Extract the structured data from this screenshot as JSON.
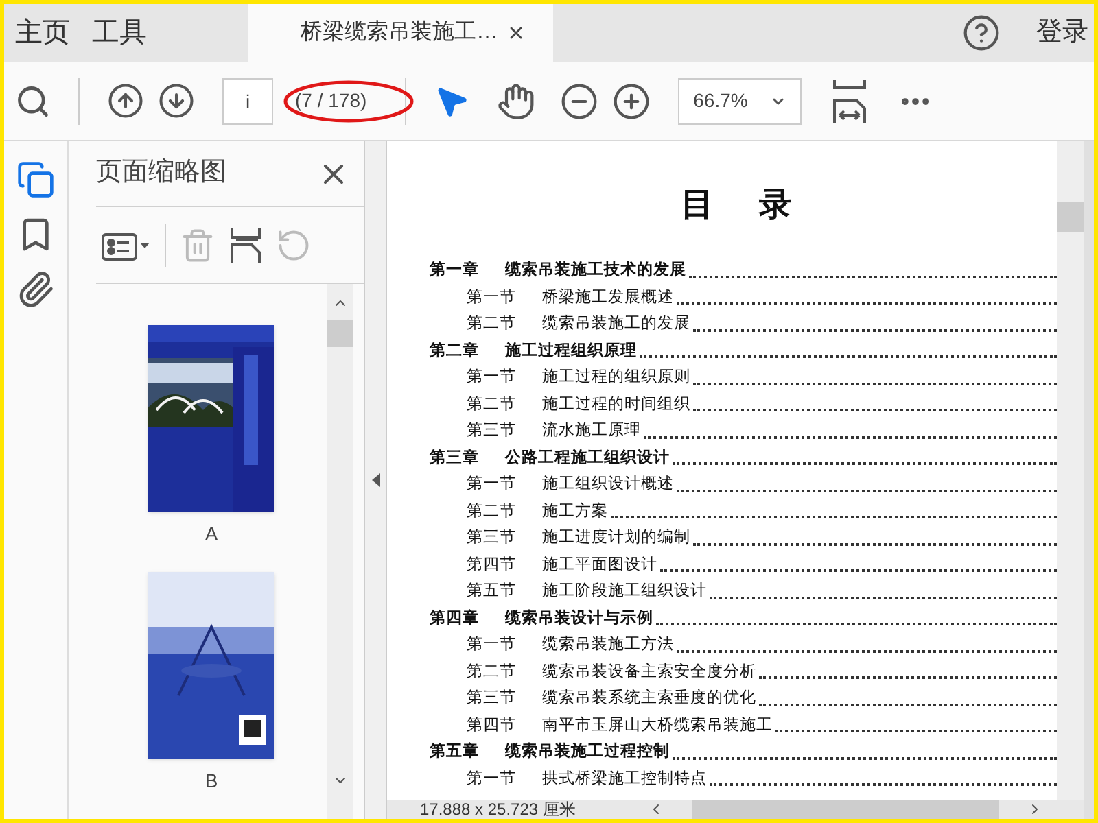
{
  "tabs": [
    {
      "label": "主页",
      "selected": false
    },
    {
      "label": "工具",
      "selected": false
    },
    {
      "label": "桥梁缆索吊装施工…",
      "selected": true
    }
  ],
  "login": "登录",
  "toolbar": {
    "page_field": {
      "value": "i"
    },
    "page_count": "(7 / 178)",
    "zoom": "66.7%"
  },
  "side_nav": [
    {
      "kind": "pages",
      "selected": true
    },
    {
      "kind": "bookmarks",
      "selected": false
    },
    {
      "kind": "attachments",
      "selected": false
    }
  ],
  "thumbnail_panel": {
    "title": "页面缩略图",
    "thumbnails": [
      {
        "label": "A"
      },
      {
        "label": "B"
      }
    ]
  },
  "document": {
    "title": "目    录",
    "toc": [
      {
        "kind": "chapter",
        "label": "第一章",
        "text": "缆索吊装施工技术的发展"
      },
      {
        "kind": "section",
        "label": "第一节",
        "text": "桥梁施工发展概述"
      },
      {
        "kind": "section",
        "label": "第二节",
        "text": "缆索吊装施工的发展"
      },
      {
        "kind": "chapter",
        "label": "第二章",
        "text": "施工过程组织原理"
      },
      {
        "kind": "section",
        "label": "第一节",
        "text": "施工过程的组织原则"
      },
      {
        "kind": "section",
        "label": "第二节",
        "text": "施工过程的时间组织"
      },
      {
        "kind": "section",
        "label": "第三节",
        "text": "流水施工原理"
      },
      {
        "kind": "chapter",
        "label": "第三章",
        "text": "公路工程施工组织设计"
      },
      {
        "kind": "section",
        "label": "第一节",
        "text": "施工组织设计概述"
      },
      {
        "kind": "section",
        "label": "第二节",
        "text": "施工方案"
      },
      {
        "kind": "section",
        "label": "第三节",
        "text": "施工进度计划的编制"
      },
      {
        "kind": "section",
        "label": "第四节",
        "text": "施工平面图设计"
      },
      {
        "kind": "section",
        "label": "第五节",
        "text": "施工阶段施工组织设计"
      },
      {
        "kind": "chapter",
        "label": "第四章",
        "text": "缆索吊装设计与示例"
      },
      {
        "kind": "section",
        "label": "第一节",
        "text": "缆索吊装施工方法"
      },
      {
        "kind": "section",
        "label": "第二节",
        "text": "缆索吊装设备主索安全度分析"
      },
      {
        "kind": "section",
        "label": "第三节",
        "text": "缆索吊装系统主索垂度的优化"
      },
      {
        "kind": "section",
        "label": "第四节",
        "text": "南平市玉屏山大桥缆索吊装施工"
      },
      {
        "kind": "chapter",
        "label": "第五章",
        "text": "缆索吊装施工过程控制"
      },
      {
        "kind": "section",
        "label": "第一节",
        "text": "拱式桥梁施工控制特点"
      }
    ]
  },
  "status_bar": {
    "page_size": "17.888 x 25.723 厘米"
  }
}
